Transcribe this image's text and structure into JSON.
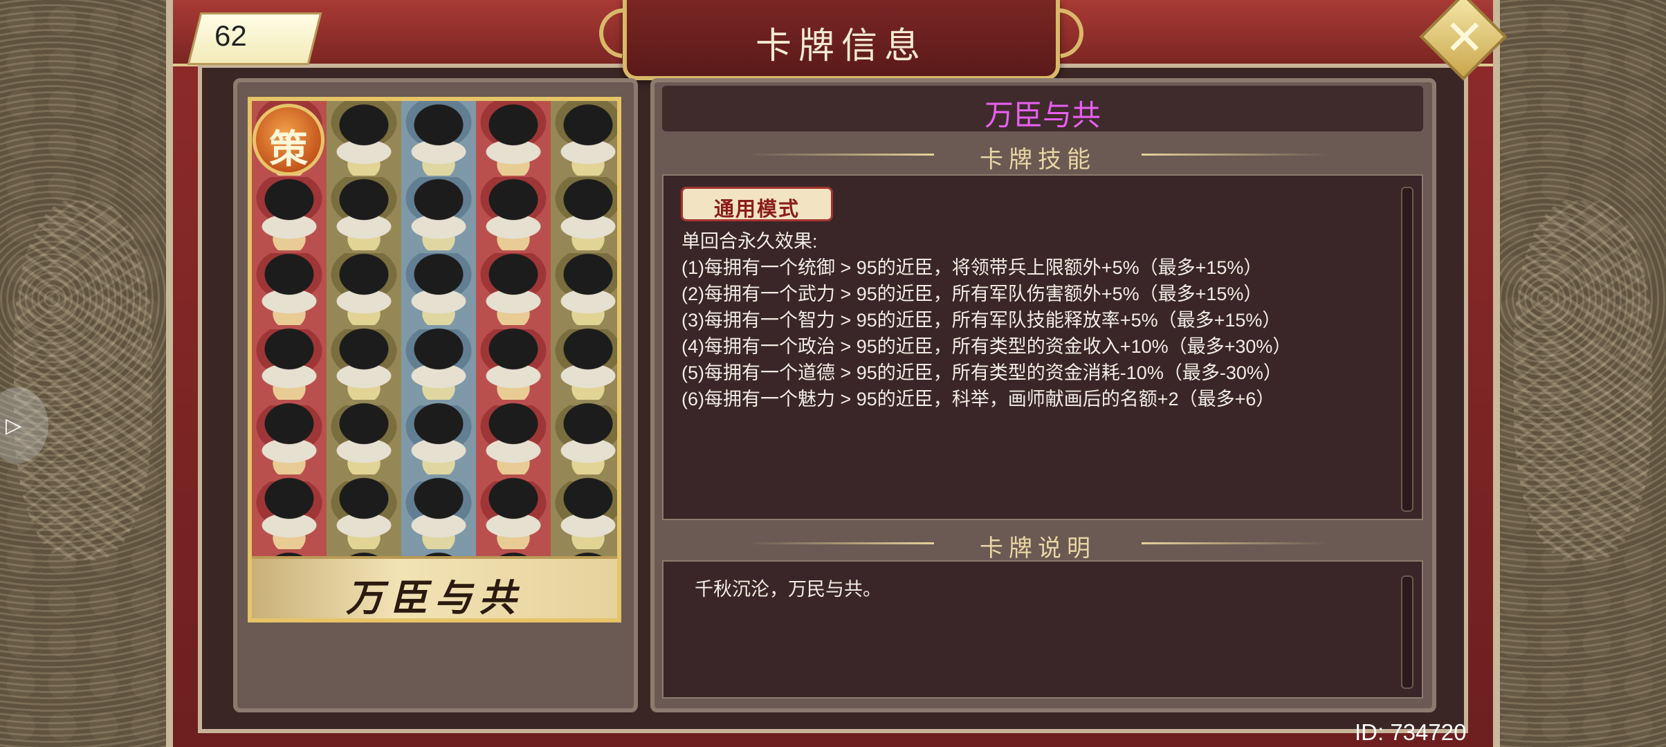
{
  "header": {
    "title": "卡牌信息",
    "count": "62",
    "close_icon": "close-x-icon"
  },
  "card": {
    "name_on_art": "万臣与共",
    "badge": "策",
    "title": "万臣与共",
    "title_color": "#e660f0"
  },
  "skill_section": {
    "heading": "卡牌技能",
    "mode_tag": "通用模式",
    "lines": [
      "单回合永久效果:",
      "(1)每拥有一个统御 > 95的近臣，将领带兵上限额外+5%（最多+15%）",
      "(2)每拥有一个武力 > 95的近臣，所有军队伤害额外+5%（最多+15%）",
      "(3)每拥有一个智力 > 95的近臣，所有军队技能释放率+5%（最多+15%）",
      "(4)每拥有一个政治 > 95的近臣，所有类型的资金收入+10%（最多+30%）",
      "(5)每拥有一个道德 > 95的近臣，所有类型的资金消耗-10%（最多-30%）",
      "(6)每拥有一个魅力 > 95的近臣，科举，画师献画后的名额+2（最多+6）"
    ]
  },
  "desc_section": {
    "heading": "卡牌说明",
    "text": "千秋沉沦，万民与共。"
  },
  "footer": {
    "id": "ID: 734720"
  }
}
